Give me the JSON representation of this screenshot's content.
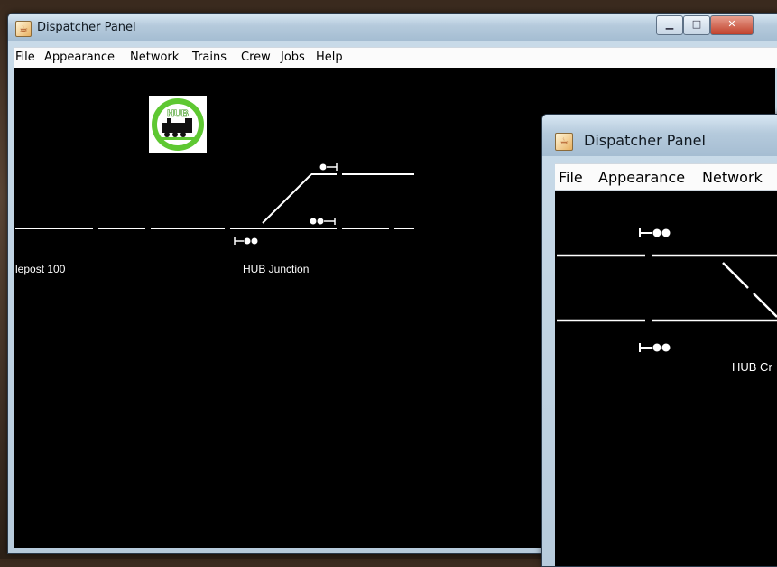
{
  "window_main": {
    "title": "Dispatcher Panel",
    "title_icon": "java-coffee-cup-icon",
    "menu": [
      "File",
      "Appearance",
      "Network",
      "Trains",
      "Crew",
      "Jobs",
      "Help"
    ],
    "controls": {
      "minimize": "minimize-icon",
      "maximize": "maximize-icon",
      "close": "close-icon"
    },
    "logo_text": "HUB",
    "labels": {
      "milepost": "lepost 100",
      "junction": "HUB Junction"
    }
  },
  "window_second": {
    "title": "Dispatcher Panel",
    "title_icon": "java-coffee-cup-icon",
    "menu": [
      "File",
      "Appearance",
      "Network"
    ],
    "labels": {
      "crossing": "HUB Cr"
    }
  },
  "colors": {
    "track": "#ffffff",
    "canvas": "#000000",
    "logo_green": "#5ec832"
  }
}
